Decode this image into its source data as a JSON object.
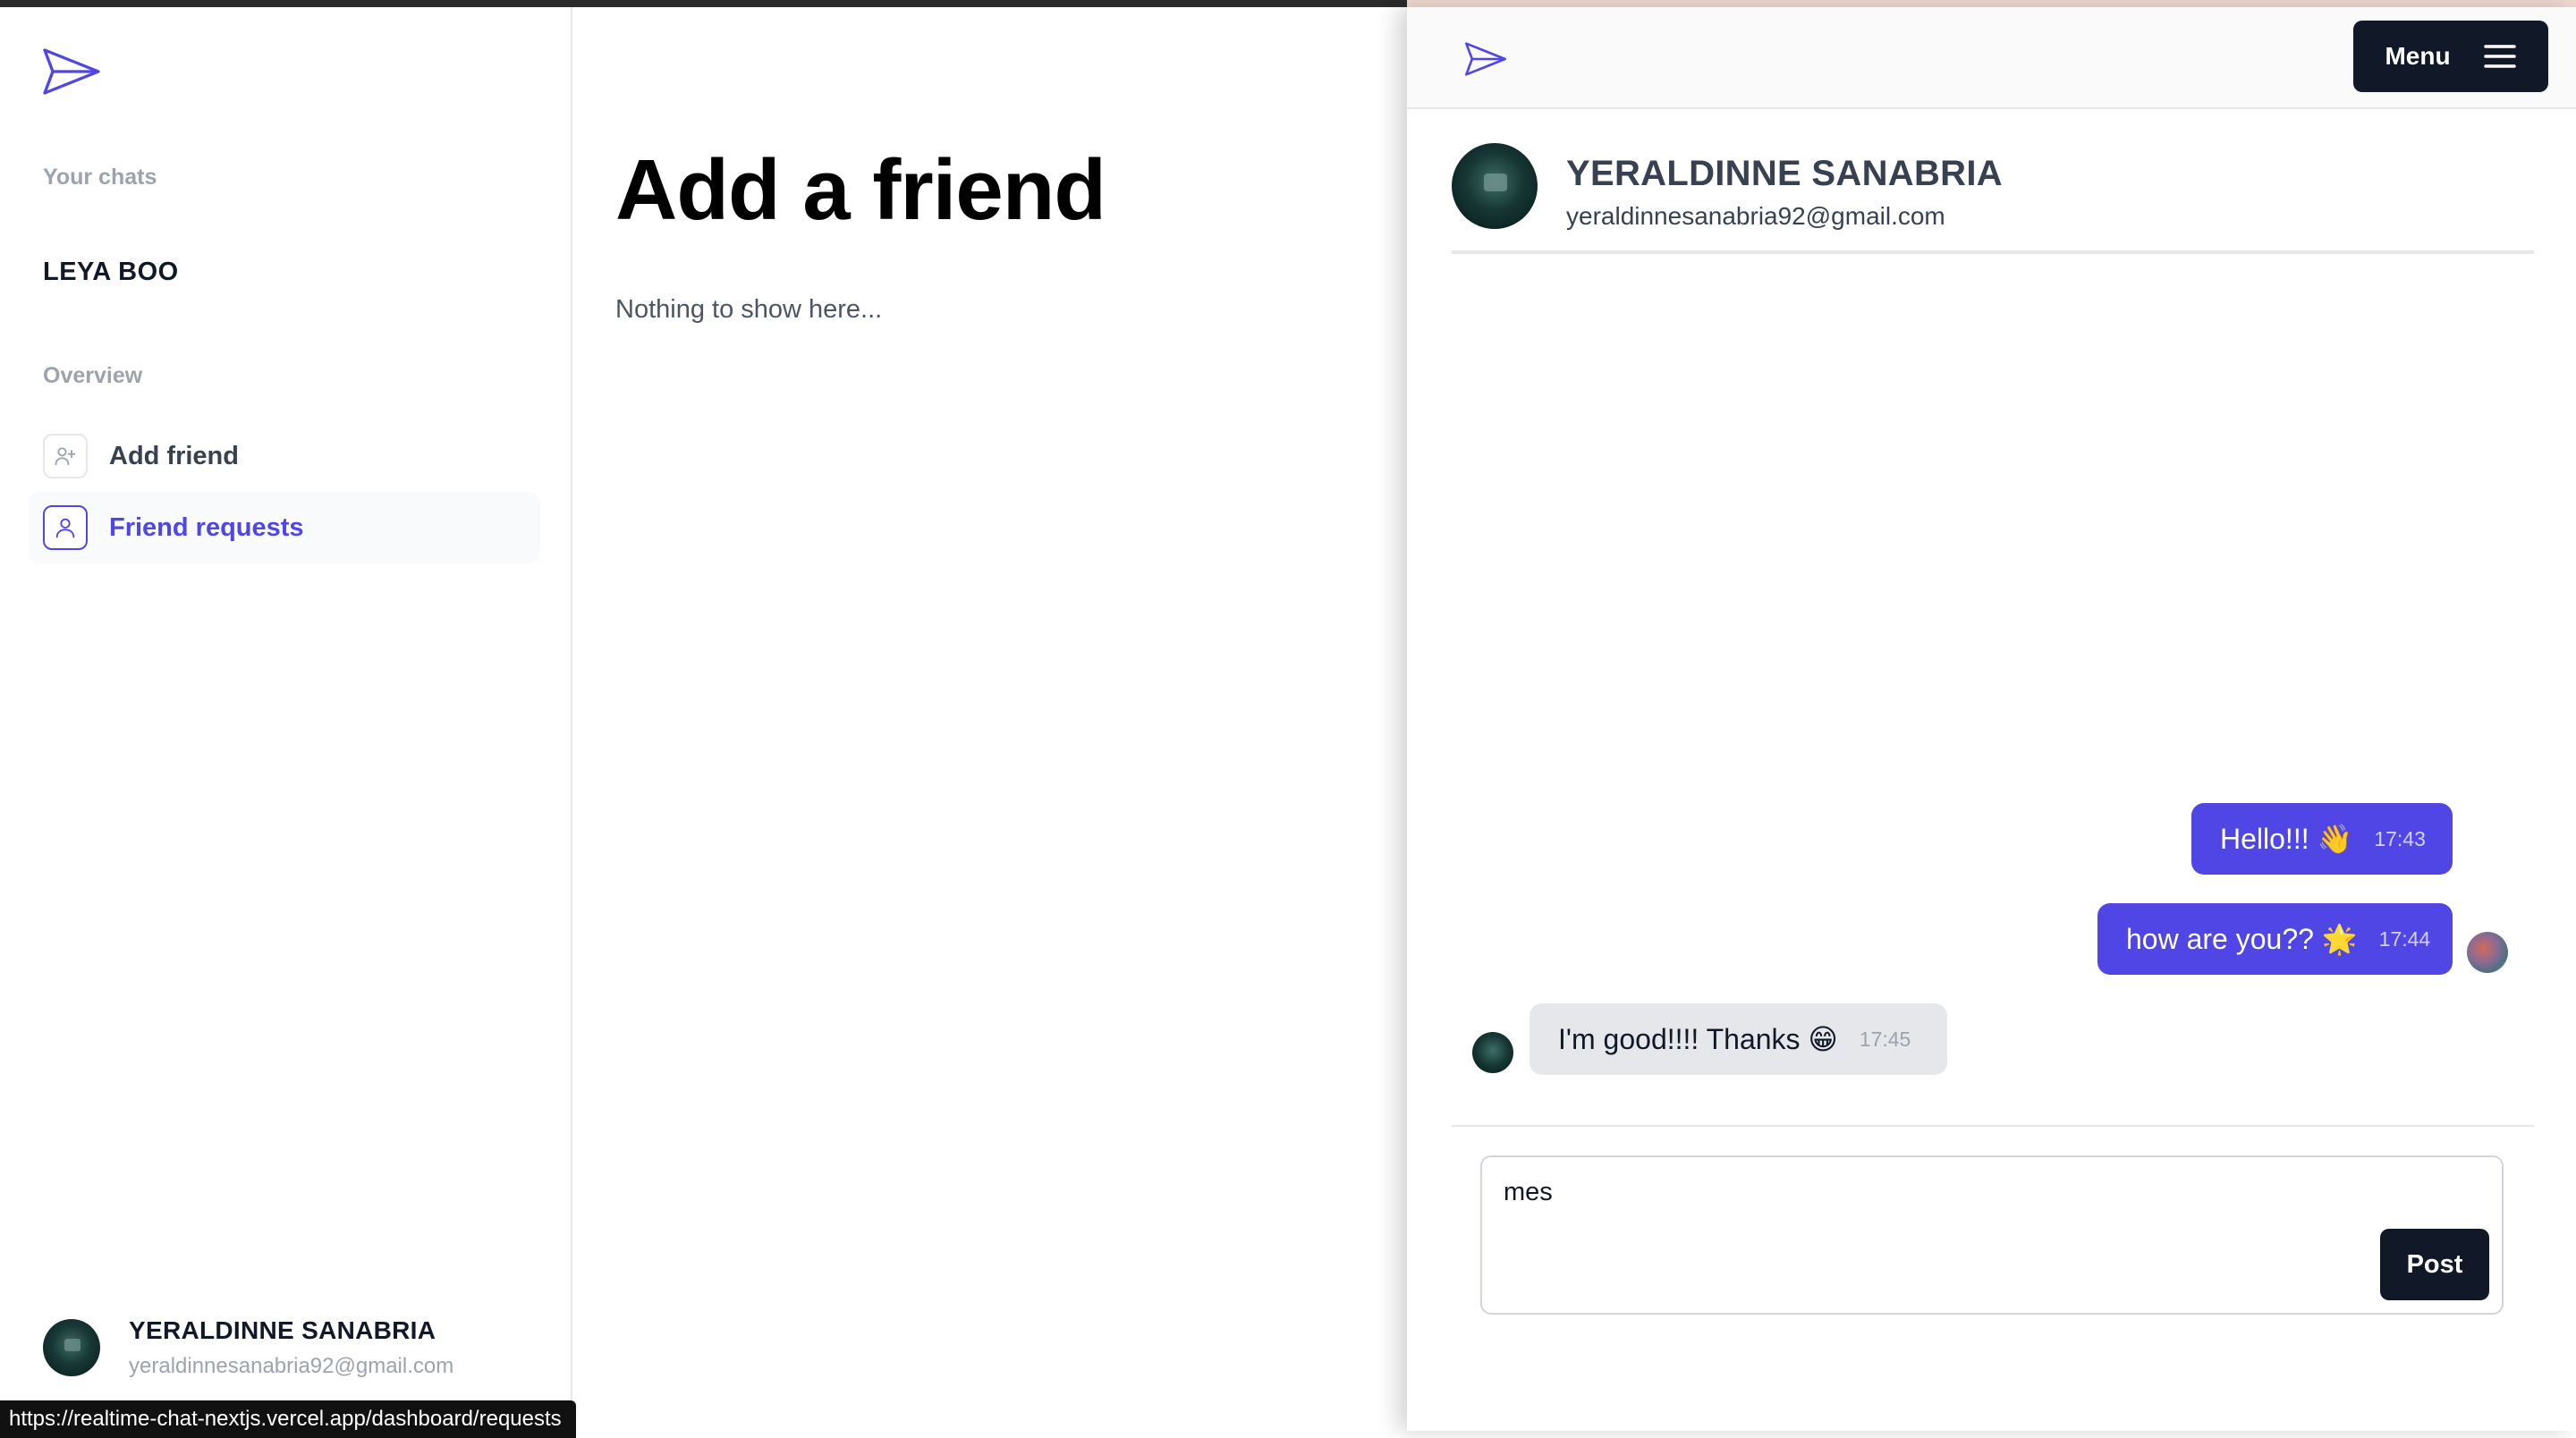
{
  "left": {
    "sidebar": {
      "your_chats_label": "Your chats",
      "chats": [
        {
          "name": "LEYA BOO"
        }
      ],
      "overview_label": "Overview",
      "nav": [
        {
          "label": "Add friend",
          "icon": "user-plus-icon",
          "active": false
        },
        {
          "label": "Friend requests",
          "icon": "user-icon",
          "active": true
        }
      ],
      "profile": {
        "name": "YERALDINNE SANABRIA",
        "email": "yeraldinnesanabria92@gmail.com"
      }
    },
    "main": {
      "title": "Add a friend",
      "empty_text": "Nothing to show here..."
    },
    "status_url": "https://realtime-chat-nextjs.vercel.app/dashboard/requests"
  },
  "right": {
    "header": {
      "menu_label": "Menu"
    },
    "chat_partner": {
      "name": "YERALDINNE SANABRIA",
      "email": "yeraldinnesanabria92@gmail.com"
    },
    "messages": [
      {
        "text": "Hello!!! 👋",
        "time": "17:43",
        "direction": "out"
      },
      {
        "text": "how are you?? 🌟",
        "time": "17:44",
        "direction": "out"
      },
      {
        "text": "I'm good!!!! Thanks 😁",
        "time": "17:45",
        "direction": "in"
      }
    ],
    "composer": {
      "value": "mes",
      "post_label": "Post"
    }
  },
  "colors": {
    "accent": "#4f46e5",
    "dark": "#111827",
    "incoming_bubble": "#e5e7eb"
  }
}
